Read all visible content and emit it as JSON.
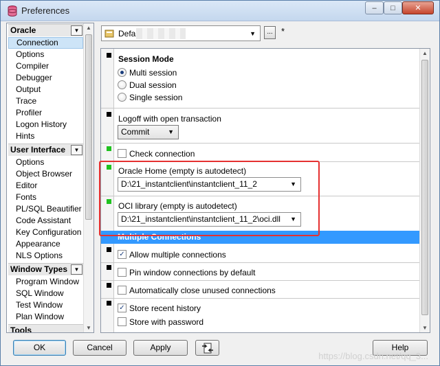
{
  "window": {
    "title": "Preferences",
    "min_label": "–",
    "max_label": "□",
    "close_label": "✕"
  },
  "nav": {
    "groups": [
      {
        "label": "Oracle",
        "items": [
          "Connection",
          "Options",
          "Compiler",
          "Debugger",
          "Output",
          "Trace",
          "Profiler",
          "Logon History",
          "Hints"
        ]
      },
      {
        "label": "User Interface",
        "items": [
          "Options",
          "Object Browser",
          "Editor",
          "Fonts",
          "PL/SQL Beautifier",
          "Code Assistant",
          "Key Configuration",
          "Appearance",
          "NLS Options"
        ]
      },
      {
        "label": "Window Types",
        "items": [
          "Program Window",
          "SQL Window",
          "Test Window",
          "Plan Window"
        ]
      },
      {
        "label": "Tools",
        "items": []
      }
    ],
    "selected": "Connection"
  },
  "profile": {
    "value": "Defa",
    "dots_label": "...",
    "modified_marker": "*"
  },
  "session_mode": {
    "title": "Session Mode",
    "options": [
      {
        "label": "Multi session",
        "selected": true
      },
      {
        "label": "Dual session",
        "selected": false
      },
      {
        "label": "Single session",
        "selected": false
      }
    ]
  },
  "logoff": {
    "label": "Logoff with open transaction",
    "value": "Commit"
  },
  "check_connection": {
    "label": "Check connection",
    "checked": false
  },
  "oracle_home": {
    "label": "Oracle Home (empty is autodetect)",
    "value": "D:\\21_instantclient\\instantclient_11_2"
  },
  "oci_library": {
    "label": "OCI library (empty is autodetect)",
    "value": "D:\\21_instantclient\\instantclient_11_2\\oci.dll"
  },
  "multiple_connections": {
    "header": "Multiple Connections",
    "allow_multiple": {
      "label": "Allow multiple connections",
      "checked": true
    },
    "pin_window": {
      "label": "Pin window connections by default",
      "checked": false
    },
    "auto_close": {
      "label": "Automatically close unused connections",
      "checked": false
    },
    "store_history": {
      "label": "Store recent history",
      "checked": true
    },
    "store_password": {
      "label": "Store with password",
      "checked": false
    }
  },
  "buttons": {
    "ok": "OK",
    "cancel": "Cancel",
    "apply": "Apply",
    "help": "Help"
  },
  "watermark": "https://blog.csdn.net/qq_3..."
}
